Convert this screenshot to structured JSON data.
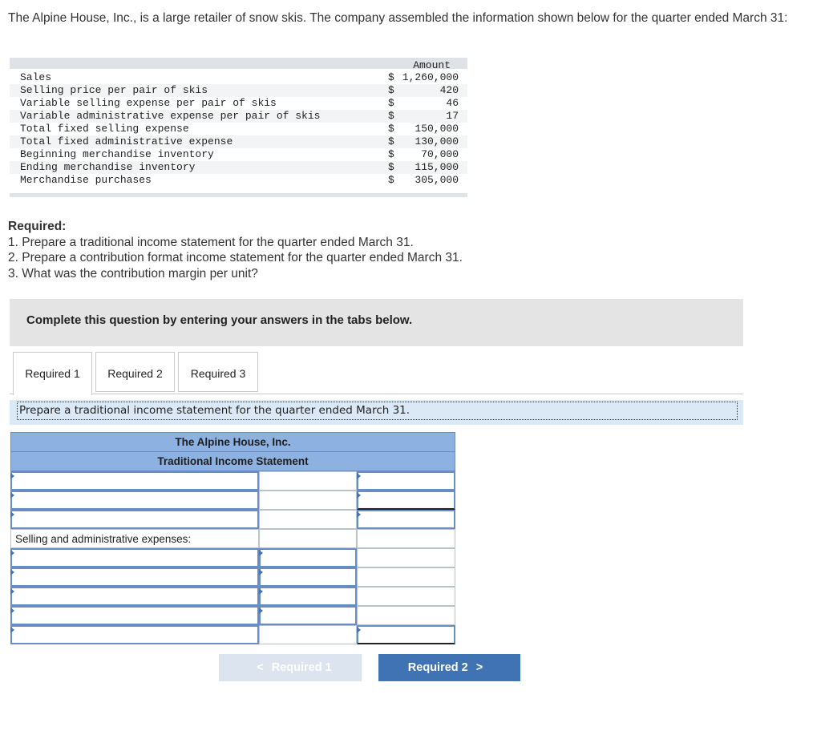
{
  "intro": "The Alpine House, Inc., is a large retailer of snow skis. The company assembled the information shown below for the quarter ended March 31:",
  "data_table": {
    "header": "Amount",
    "rows": [
      {
        "label": "Sales",
        "currency": "$",
        "value": "1,260,000"
      },
      {
        "label": "Selling price per pair of skis",
        "currency": "$",
        "value": "420"
      },
      {
        "label": "Variable selling expense per pair of skis",
        "currency": "$",
        "value": "46"
      },
      {
        "label": "Variable administrative expense per pair of skis",
        "currency": "$",
        "value": "17"
      },
      {
        "label": "Total fixed selling expense",
        "currency": "$",
        "value": "150,000"
      },
      {
        "label": "Total fixed administrative expense",
        "currency": "$",
        "value": "130,000"
      },
      {
        "label": "Beginning merchandise inventory",
        "currency": "$",
        "value": "70,000"
      },
      {
        "label": "Ending merchandise inventory",
        "currency": "$",
        "value": "115,000"
      },
      {
        "label": "Merchandise purchases",
        "currency": "$",
        "value": "305,000"
      }
    ]
  },
  "required": {
    "heading": "Required:",
    "items": [
      "1. Prepare a traditional income statement for the quarter ended March 31.",
      "2. Prepare a contribution format income statement for the quarter ended March 31.",
      "3. What was the contribution margin per unit?"
    ]
  },
  "banner": "Complete this question by entering your answers in the tabs below.",
  "tabs": [
    "Required 1",
    "Required 2",
    "Required 3"
  ],
  "active_tab": "Required 1",
  "instruction": "Prepare a traditional income statement for the quarter ended March 31.",
  "statement": {
    "title": "The Alpine House, Inc.",
    "subtitle": "Traditional Income Statement",
    "sga_label": "Selling and administrative expenses:"
  },
  "nav": {
    "prev_label": "Required 1",
    "next_label": "Required 2",
    "prev_chevron": "<",
    "next_chevron": ">"
  },
  "colors": {
    "header_fill": "#8db1e0",
    "input_border": "#6a8cc4",
    "next_button": "#3f73b3",
    "prev_button_disabled": "#dbe4ef",
    "banner": "#e4e4e4"
  }
}
